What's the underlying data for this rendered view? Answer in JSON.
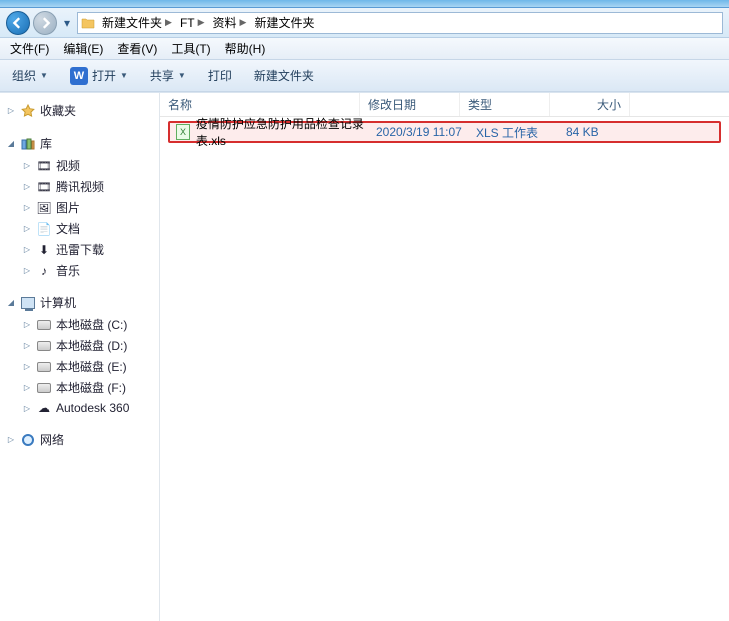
{
  "breadcrumb": {
    "items": [
      "新建文件夹",
      "FT",
      "资料",
      "新建文件夹"
    ]
  },
  "menu": {
    "file": "文件(F)",
    "edit": "编辑(E)",
    "view": "查看(V)",
    "tools": "工具(T)",
    "help": "帮助(H)"
  },
  "toolbar": {
    "organize": "组织",
    "open_badge": "W",
    "open": "打开",
    "share": "共享",
    "print": "打印",
    "newfolder": "新建文件夹"
  },
  "sidebar": {
    "favorites": {
      "label": "收藏夹"
    },
    "libraries": {
      "label": "库",
      "children": [
        "视频",
        "腾讯视频",
        "图片",
        "文档",
        "迅雷下载",
        "音乐"
      ]
    },
    "computer": {
      "label": "计算机",
      "children": [
        "本地磁盘 (C:)",
        "本地磁盘 (D:)",
        "本地磁盘 (E:)",
        "本地磁盘 (F:)",
        "Autodesk 360"
      ]
    },
    "network": {
      "label": "网络"
    }
  },
  "columns": {
    "name": "名称",
    "date": "修改日期",
    "type": "类型",
    "size": "大小"
  },
  "files": [
    {
      "name": "疫情防护应急防护用品检查记录表.xls",
      "date": "2020/3/19 11:07",
      "type": "XLS 工作表",
      "size": "84 KB"
    }
  ]
}
